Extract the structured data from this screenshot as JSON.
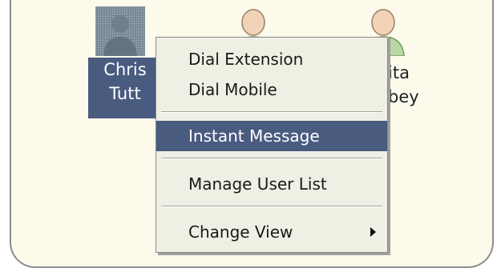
{
  "users": [
    {
      "name_line1": "Chris",
      "name_line2": "Tutt",
      "selected": true,
      "avatar_icon": "user-photo-icon"
    },
    {
      "name_line1": "",
      "name_line2": "",
      "selected": false,
      "avatar_icon": "user-icon"
    },
    {
      "name_line1": "ita",
      "name_line2": "bey",
      "selected": false,
      "avatar_icon": "user-icon"
    }
  ],
  "context_menu": {
    "items": [
      {
        "label": "Dial Extension"
      },
      {
        "label": "Dial Mobile"
      },
      {
        "label": "Instant Message",
        "highlighted": true
      },
      {
        "label": "Manage User List"
      },
      {
        "label": "Change View",
        "submenu": true
      }
    ]
  },
  "colors": {
    "panel_bg": "#fbfaeb",
    "selection": "#4a5b80",
    "menu_bg": "#f0efe4"
  }
}
